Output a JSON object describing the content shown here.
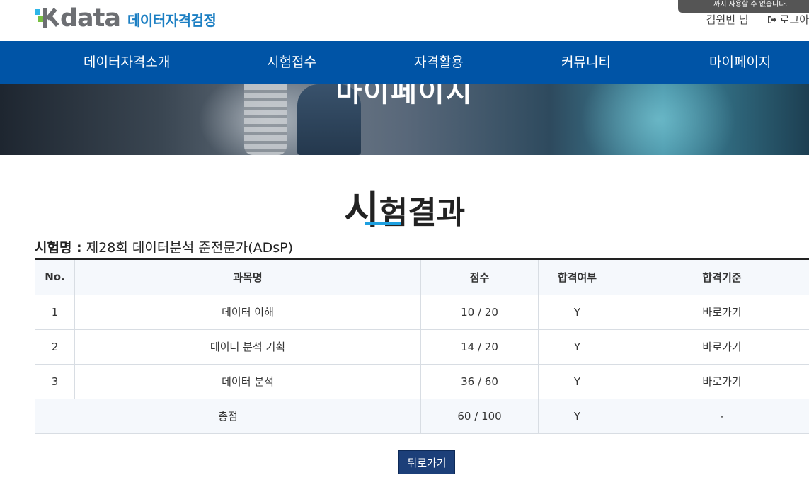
{
  "header": {
    "logo_word": "data",
    "logo_sub": "데이터자격검정",
    "user_name": "김원빈 님",
    "logout_label": "로그아",
    "toast_text": "까지 사용할 수 없습니다."
  },
  "nav": {
    "items": [
      {
        "label": "데이터자격소개"
      },
      {
        "label": "시험접수"
      },
      {
        "label": "자격활용"
      },
      {
        "label": "커뮤니티"
      },
      {
        "label": "마이페이지"
      }
    ]
  },
  "banner": {
    "title": "마이페이지"
  },
  "page": {
    "title_first": "시",
    "title_rest": "험결과",
    "exam_label": "시험명 :",
    "exam_name": "제28회 데이터분석 준전문가(ADsP)"
  },
  "table": {
    "headers": [
      "No.",
      "과목명",
      "점수",
      "합격여부",
      "합격기준"
    ],
    "rows": [
      {
        "no": "1",
        "subject": "데이터 이해",
        "score": "10 / 20",
        "pass": "Y",
        "criteria": "바로가기"
      },
      {
        "no": "2",
        "subject": "데이터 분석 기획",
        "score": "14 / 20",
        "pass": "Y",
        "criteria": "바로가기"
      },
      {
        "no": "3",
        "subject": "데이터 분석",
        "score": "36 / 60",
        "pass": "Y",
        "criteria": "바로가기"
      }
    ],
    "total": {
      "label": "총점",
      "score": "60 / 100",
      "pass": "Y",
      "criteria": "-"
    }
  },
  "buttons": {
    "back_label": "뒤로가기"
  },
  "colors": {
    "nav_bg": "#0054a6",
    "accent_underline": "#1ea0e0",
    "back_button": "#1c3f79"
  }
}
